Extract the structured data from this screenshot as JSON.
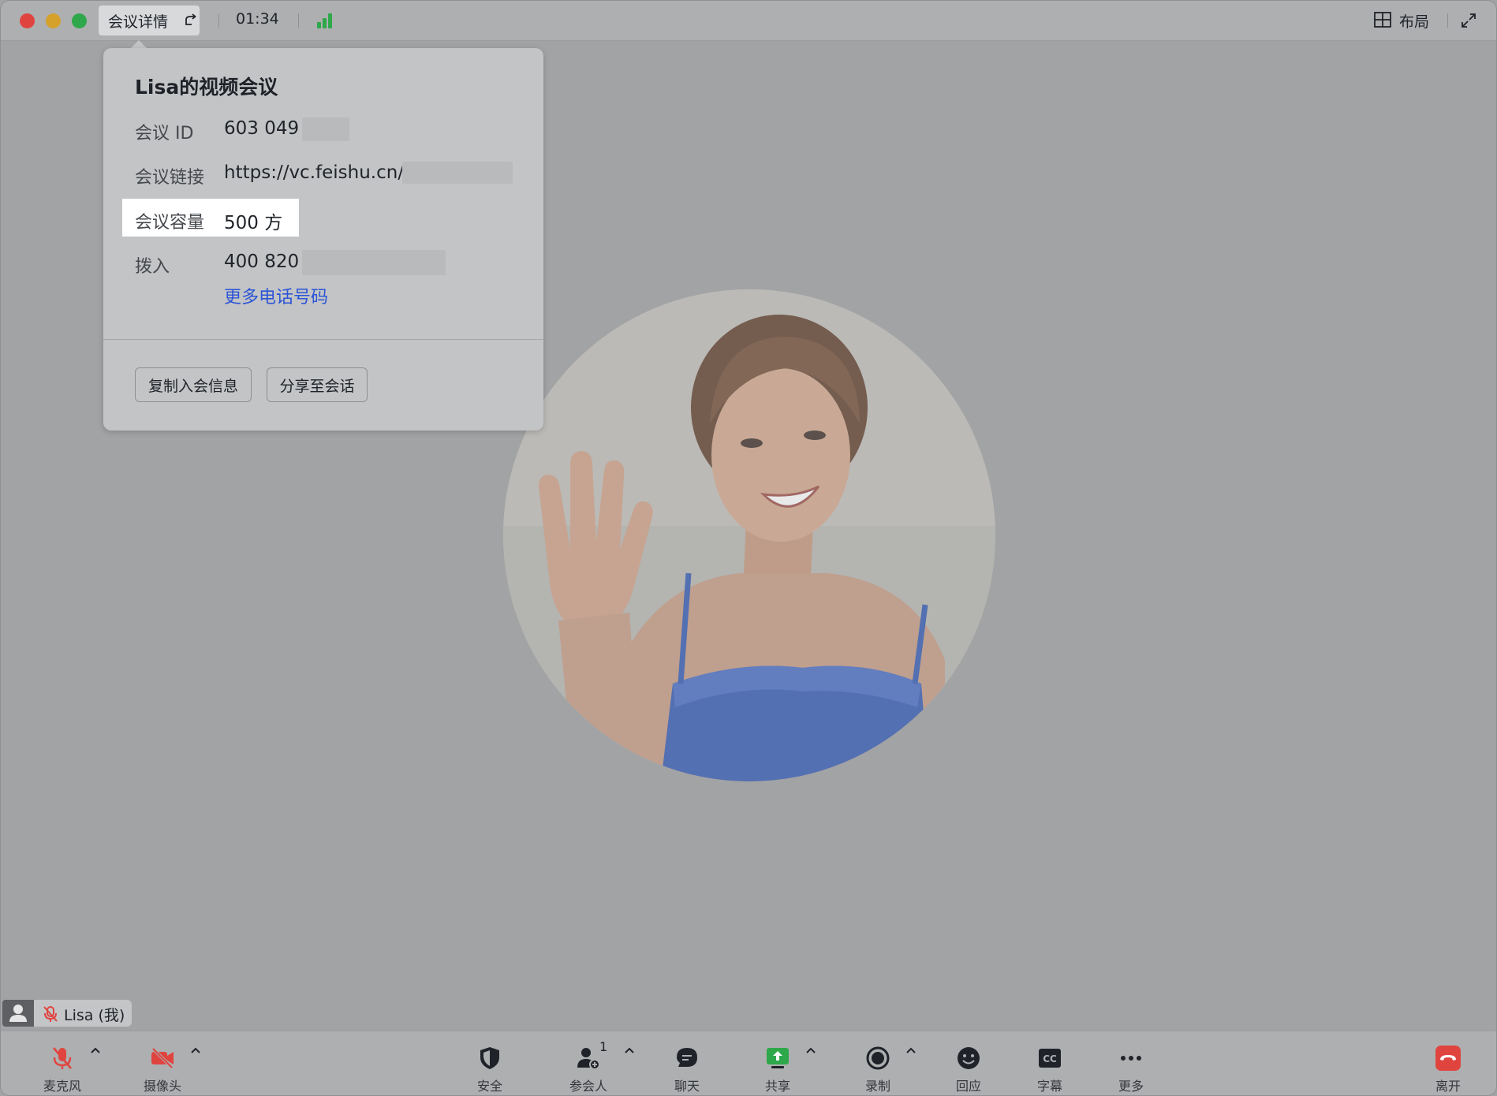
{
  "topbar": {
    "details_label": "会议详情",
    "timer": "01:34",
    "layout_label": "布局"
  },
  "meeting": {
    "title": "Lisa的视频会议",
    "rows": [
      {
        "label": "会议 ID",
        "value": "603 049"
      },
      {
        "label": "会议链接",
        "value": "https://vc.feishu.cn/j"
      },
      {
        "label": "会议容量",
        "value": "500 方"
      },
      {
        "label": "拨入",
        "value": "400 820"
      }
    ],
    "more_numbers_link": "更多电话号码",
    "copy_button": "复制入会信息",
    "share_button": "分享至会话"
  },
  "participant": {
    "name": "Lisa (我)"
  },
  "toolbar": {
    "mic": "麦克风",
    "camera": "摄像头",
    "security": "安全",
    "participants": "参会人",
    "participants_count": "1",
    "chat": "聊天",
    "share": "共享",
    "record": "录制",
    "reaction": "回应",
    "captions": "字幕",
    "more": "更多",
    "leave": "离开"
  },
  "colors": {
    "accent_link": "#2c55d6",
    "muted_red": "#e0443e",
    "share_green": "#2ea84a",
    "leave_red": "#e0443e",
    "highlight": "#ffffff"
  }
}
